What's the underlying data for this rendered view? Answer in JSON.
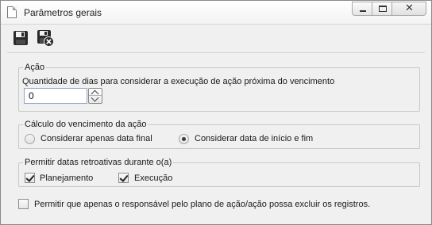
{
  "window": {
    "title": "Parâmetros gerais",
    "controls": {
      "minimize": "minimize-icon",
      "maximize": "maximize-icon",
      "close": "close-icon"
    }
  },
  "toolbar": {
    "save": {
      "icon": "save-icon"
    },
    "save_close": {
      "icon": "save-close-icon"
    }
  },
  "acao": {
    "legend": "Ação",
    "days_label": "Quantidade de dias para considerar a execução de ação próxima do vencimento",
    "days_value": "0"
  },
  "calculo": {
    "legend": "Cálculo do vencimento da ação",
    "options": [
      {
        "label": "Considerar apenas data final",
        "selected": false
      },
      {
        "label": "Considerar data de início e fim",
        "selected": true
      }
    ]
  },
  "retroativas": {
    "legend": "Permitir datas retroativas durante o(a)",
    "options": [
      {
        "label": "Planejamento",
        "checked": true
      },
      {
        "label": "Execução",
        "checked": true
      }
    ]
  },
  "permission": {
    "label": "Permitir que apenas o responsável pelo plano de ação/ação possa excluir os registros.",
    "checked": false
  }
}
